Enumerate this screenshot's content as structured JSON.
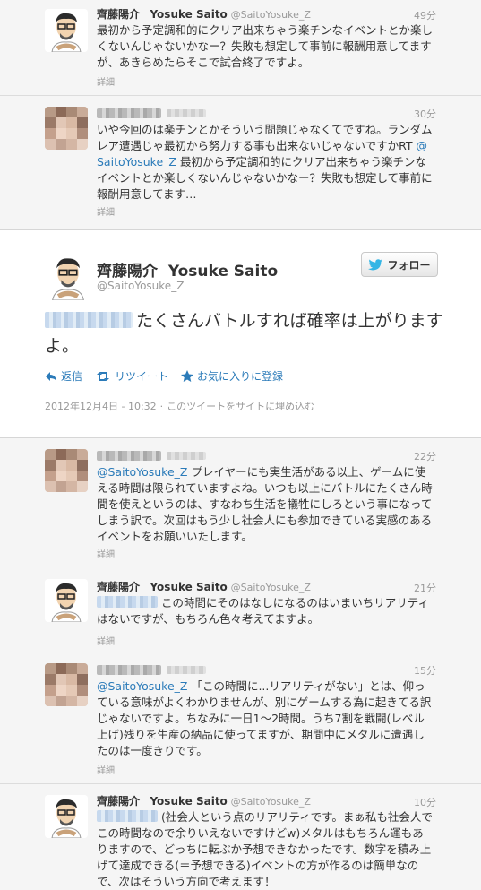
{
  "tweets": [
    {
      "name": "齊藤陽介",
      "name_en": "Yosuke Saito",
      "screen": "@SaitoYosuke_Z",
      "time": "49分",
      "text": "最初から予定調和的にクリア出来ちゃう楽チンなイベントとか楽しくないんじゃないかなー？失敗も想定して事前に報酬用意してますが、あきらめたらそこで試合終了ですよ。",
      "detail": "詳細"
    },
    {
      "time": "30分",
      "text_before": "いや今回のは楽チンとかそういう問題じゃなくてですね。ランダムレア遭遇じゃ最初から努力する事も出来ないじゃないですかRT ",
      "mention": "@SaitoYosuke_Z",
      "text_after": " 最初から予定調和的にクリア出来ちゃう楽チンなイベントとか楽しくないんじゃないかなー？失敗も想定して事前に報酬用意してます…",
      "detail": "詳細"
    },
    {
      "time": "22分",
      "mention": "@SaitoYosuke_Z",
      "text_after": " プレイヤーにも実生活がある以上、ゲームに使える時間は限られていますよね。いつも以上にバトルにたくさん時間を使えというのは、すなわち生活を犠牲にしろという事になってしまう訳で。次回はもう少し社会人にも参加できている実感のあるイベントをお願いいたします。",
      "detail": "詳細"
    },
    {
      "name": "齊藤陽介",
      "name_en": "Yosuke Saito",
      "screen": "@SaitoYosuke_Z",
      "time": "21分",
      "text": "この時間にそのはなしになるのはいまいちリアリティはないですが、もちろん色々考えてますよ。",
      "detail": "詳細"
    },
    {
      "time": "15分",
      "mention": "@SaitoYosuke_Z",
      "text_after": " 「この時間に...リアリティがない」とは、仰っている意味がよくわかりませんが、別にゲームする為に起きてる訳じゃないですよ。ちなみに一日1〜2時間。うち7割を戦闘(レベル上げ)残りを生産の納品に使ってますが、期間中にメタルに遭遇したのは一度きりです。",
      "detail": "詳細"
    },
    {
      "name": "齊藤陽介",
      "name_en": "Yosuke Saito",
      "screen": "@SaitoYosuke_Z",
      "time": "10分",
      "text": "(社会人という点のリアリティです。まぁ私も社会人でこの時間なので余りいえないですけどw)メタルはもちろん運もありますので、どっちに転ぶか予想できなかったです。数字を積み上げて達成できる(＝予想できる)イベントの方が作るのは簡単なので、次はそういう方向で考えます！"
    }
  ],
  "main_tweet": {
    "name": "齊藤陽介",
    "name_en": "Yosuke Saito",
    "screen": "@SaitoYosuke_Z",
    "follow_label": "フォロー",
    "text": "たくさんバトルすれば確率は上がりますよ。",
    "actions": {
      "reply": "返信",
      "retweet": "リツイート",
      "favorite": "お気に入りに登録"
    },
    "date": "2012年12月4日 - 10:32",
    "embed": "このツイートをサイトに埋め込む"
  },
  "colors": {
    "link": "#2b7bb9",
    "twitter_blue": "#33b5e5"
  },
  "icons": [
    "reply-icon",
    "retweet-icon",
    "star-icon",
    "twitter-bird-icon"
  ]
}
